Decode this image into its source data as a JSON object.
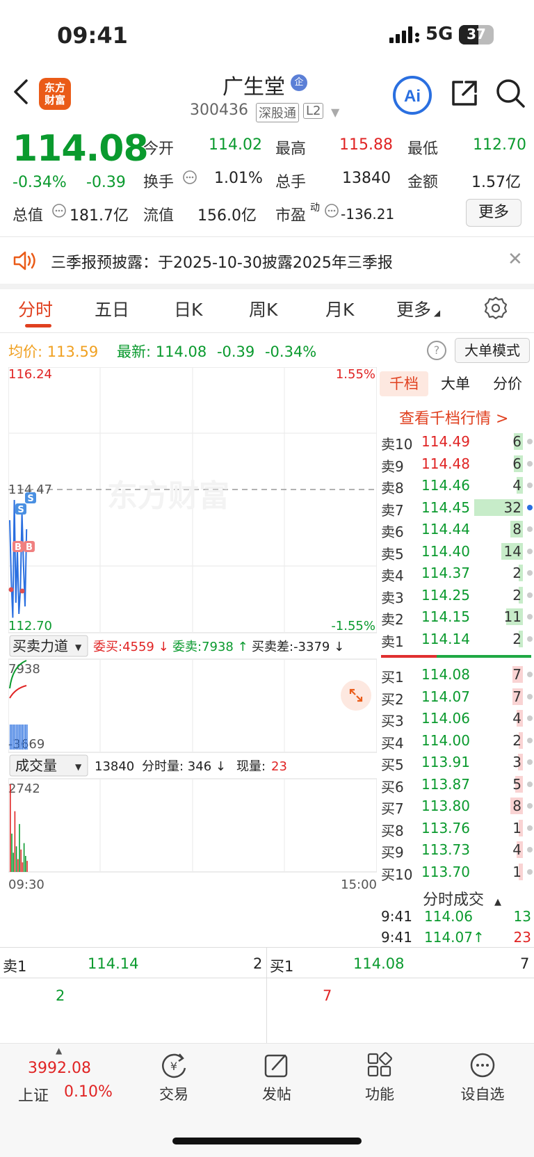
{
  "status_bar": {
    "time": "09:41",
    "network": "5G",
    "battery": "37"
  },
  "header": {
    "logo_text": "东方财富",
    "stock_name": "广生堂",
    "name_badge": "企",
    "stock_code": "300436",
    "tag_sgt": "深股通",
    "tag_l2": "L2",
    "ai_label": "Ai"
  },
  "quote": {
    "price": "114.08",
    "change_pct": "-0.34%",
    "change": "-0.39",
    "open_label": "今开",
    "open": "114.02",
    "high_label": "最高",
    "high": "115.88",
    "low_label": "最低",
    "low": "112.70",
    "turnover_label": "换手",
    "turnover": "1.01%",
    "volume_label": "总手",
    "volume": "13840",
    "amount_label": "金额",
    "amount": "1.57亿",
    "mcap_label": "总值",
    "mcap": "181.7亿",
    "float_label": "流值",
    "float_cap": "156.0亿",
    "pe_label": "市盈",
    "pe_sup": "动",
    "pe": "-136.21",
    "more_label": "更多"
  },
  "notice": {
    "text": "三季报预披露：于2025-10-30披露2025年三季报"
  },
  "tabs": [
    "分时",
    "五日",
    "日K",
    "周K",
    "月K",
    "更多"
  ],
  "summary": {
    "avg_label": "均价:",
    "avg": "113.59",
    "latest_label": "最新:",
    "latest": "114.08",
    "latest_chg": "-0.39",
    "latest_pct": "-0.34%",
    "help": "?",
    "big_mode": "大单模式"
  },
  "chart": {
    "price_high": "116.24",
    "price_low": "112.70",
    "pct_high": "1.55%",
    "pct_low": "-1.55%",
    "ref_price": "114.47",
    "watermark": "东方财富",
    "markers": [
      "S",
      "S",
      "B",
      "B"
    ],
    "force_title": "买卖力道",
    "force_buy": "委买:4559 ↓",
    "force_sell": "委卖:7938 ↑",
    "force_diff": "买卖差:-3379 ↓",
    "force_max": "7938",
    "force_min": "-3669",
    "volume_title": "成交量",
    "volume_total": "13840",
    "volume_min_label": "分时量: 346 ↓",
    "volume_now_label": "现量:",
    "volume_now": "23",
    "volume_max": "2742",
    "time_start": "09:30",
    "time_end": "15:00"
  },
  "chart_data": {
    "type": "line",
    "title": "",
    "ylim": [
      112.7,
      116.24
    ],
    "x": [
      "09:30",
      "09:31",
      "09:32",
      "09:33",
      "09:34",
      "09:35",
      "09:36",
      "09:37",
      "09:38",
      "09:39",
      "09:40",
      "09:41"
    ],
    "series": [
      {
        "values": [
          114.2,
          113.4,
          112.9,
          114.47,
          113.1,
          113.8,
          112.95,
          113.3,
          114.3,
          113.6,
          113.05,
          114.08
        ]
      }
    ],
    "volume": [
      2742,
      1200,
      600,
      1900,
      800,
      400,
      1500,
      700,
      300,
      900,
      500,
      346
    ]
  },
  "right_panel": {
    "tabs": [
      "千档",
      "大单",
      "分价"
    ],
    "link": "查看千档行情 >",
    "asks": [
      {
        "label": "卖10",
        "price": "114.49",
        "vol": "6"
      },
      {
        "label": "卖9",
        "price": "114.48",
        "vol": "6"
      },
      {
        "label": "卖8",
        "price": "114.46",
        "vol": "4"
      },
      {
        "label": "卖7",
        "price": "114.45",
        "vol": "32"
      },
      {
        "label": "卖6",
        "price": "114.44",
        "vol": "8"
      },
      {
        "label": "卖5",
        "price": "114.40",
        "vol": "14"
      },
      {
        "label": "卖4",
        "price": "114.37",
        "vol": "2"
      },
      {
        "label": "卖3",
        "price": "114.25",
        "vol": "2"
      },
      {
        "label": "卖2",
        "price": "114.15",
        "vol": "11"
      },
      {
        "label": "卖1",
        "price": "114.14",
        "vol": "2"
      }
    ],
    "bids": [
      {
        "label": "买1",
        "price": "114.08",
        "vol": "7"
      },
      {
        "label": "买2",
        "price": "114.07",
        "vol": "7"
      },
      {
        "label": "买3",
        "price": "114.06",
        "vol": "4"
      },
      {
        "label": "买4",
        "price": "114.00",
        "vol": "2"
      },
      {
        "label": "买5",
        "price": "113.91",
        "vol": "3"
      },
      {
        "label": "买6",
        "price": "113.87",
        "vol": "5"
      },
      {
        "label": "买7",
        "price": "113.80",
        "vol": "8"
      },
      {
        "label": "买8",
        "price": "113.76",
        "vol": "1"
      },
      {
        "label": "买9",
        "price": "113.73",
        "vol": "4"
      },
      {
        "label": "买10",
        "price": "113.70",
        "vol": "1"
      }
    ],
    "ticks_title": "分时成交",
    "ticks": [
      {
        "time": "9:41",
        "price": "114.06",
        "vol": "13"
      },
      {
        "time": "9:41",
        "price": "114.07↑",
        "vol": "23"
      }
    ]
  },
  "level1": {
    "ask_label": "卖1",
    "ask_price": "114.14",
    "ask_vol": "2",
    "ask_sub": "2",
    "bid_label": "买1",
    "bid_price": "114.08",
    "bid_vol": "7",
    "bid_sub": "7"
  },
  "bottom_nav": {
    "index_value": "3992.08",
    "index_name": "上证",
    "index_pct": "0.10%",
    "items": [
      "交易",
      "发帖",
      "功能",
      "设自选"
    ]
  }
}
